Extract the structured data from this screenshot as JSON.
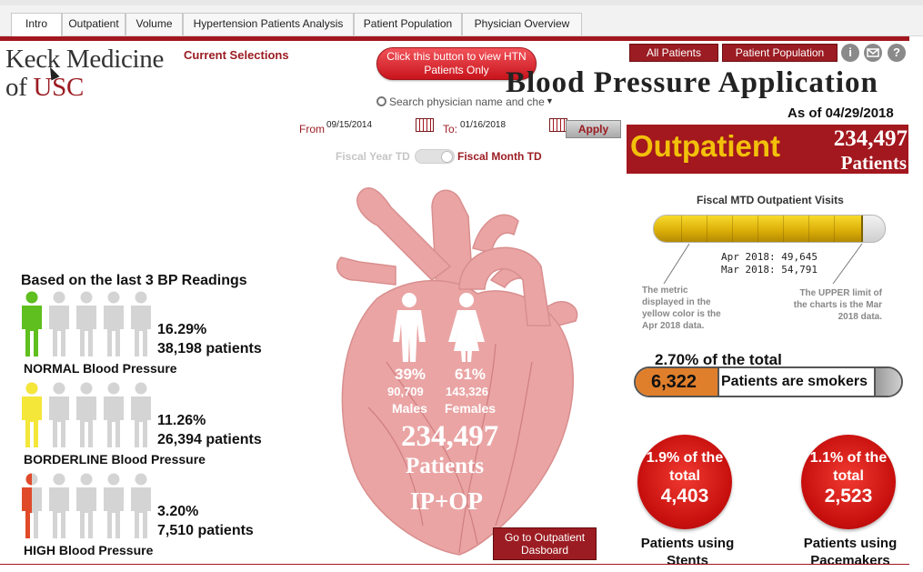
{
  "tabs": [
    {
      "label": "Intro",
      "active": true
    },
    {
      "label": "Outpatient",
      "active": false
    },
    {
      "label": "Volume",
      "active": false
    },
    {
      "label": "Hypertension Patients Analysis",
      "active": false
    },
    {
      "label": "Patient Population",
      "active": false
    },
    {
      "label": "Physician Overview",
      "active": false
    }
  ],
  "header": {
    "logo_line1": "Keck Medicine",
    "logo_of": "of ",
    "logo_usc": "USC",
    "current_selections": "Current Selections",
    "htn_button": "Click this button to view HTN Patients Only",
    "all_patients_button": "All Patients",
    "patient_population_button": "Patient Population",
    "info_icon": "i",
    "help_icon": "?",
    "app_title": "Blood Pressure  Application",
    "as_of": "As of 04/29/2018"
  },
  "filters": {
    "search_placeholder": "Search physician name and che",
    "from_label": "From",
    "from_value": "09/15/2014",
    "to_label": "To:",
    "to_value": "01/16/2018",
    "apply": "Apply",
    "toggle_left": "Fiscal Year TD",
    "toggle_right": "Fiscal Month TD"
  },
  "outpatient": {
    "label": "Outpatient",
    "count": "234,497",
    "unit": "Patients"
  },
  "mtd": {
    "title": "Fiscal MTD Outpatient Visits",
    "current_line": "Apr 2018: 49,645",
    "limit_line": "Mar 2018: 54,791",
    "fill_fraction": 0.906,
    "note_left": "The metric displayed in the yellow color is the Apr 2018 data.",
    "note_right": "The UPPER limit of the charts is the Mar 2018 data."
  },
  "smokers": {
    "title": "2.70% of the total",
    "count": "6,322",
    "text": "Patients are smokers"
  },
  "stents": {
    "pct": "1.9% of the total",
    "count": "4,403",
    "caption": "Patients using Stents"
  },
  "pacemakers": {
    "pct": "1.1% of the total",
    "count": "2,523",
    "caption": "Patients using Pacemakers"
  },
  "bp": {
    "title": "Based on the last 3 BP Readings",
    "normal": {
      "pct": "16.29%",
      "count": "38,198 patients",
      "label": "NORMAL Blood Pressure",
      "color": "#5fbf1e",
      "filled": 1
    },
    "borderline": {
      "pct": "11.26%",
      "count": "26,394 patients",
      "label": "BORDERLINE Blood Pressure",
      "color": "#f5e63a",
      "filled": 1
    },
    "high": {
      "pct": "3.20%",
      "count": "7,510 patients",
      "label": "HIGH Blood Pressure",
      "color": "#e04a2a",
      "filled": 0.5
    }
  },
  "heart": {
    "males_pct": "39%",
    "males_count": "90,709",
    "males_label": "Males",
    "females_pct": "61%",
    "females_count": "143,326",
    "females_label": "Females",
    "total": "234,497",
    "patients": "Patients",
    "ipop": "IP+OP",
    "goto_button": "Go to Outpatient Dasboard"
  }
}
